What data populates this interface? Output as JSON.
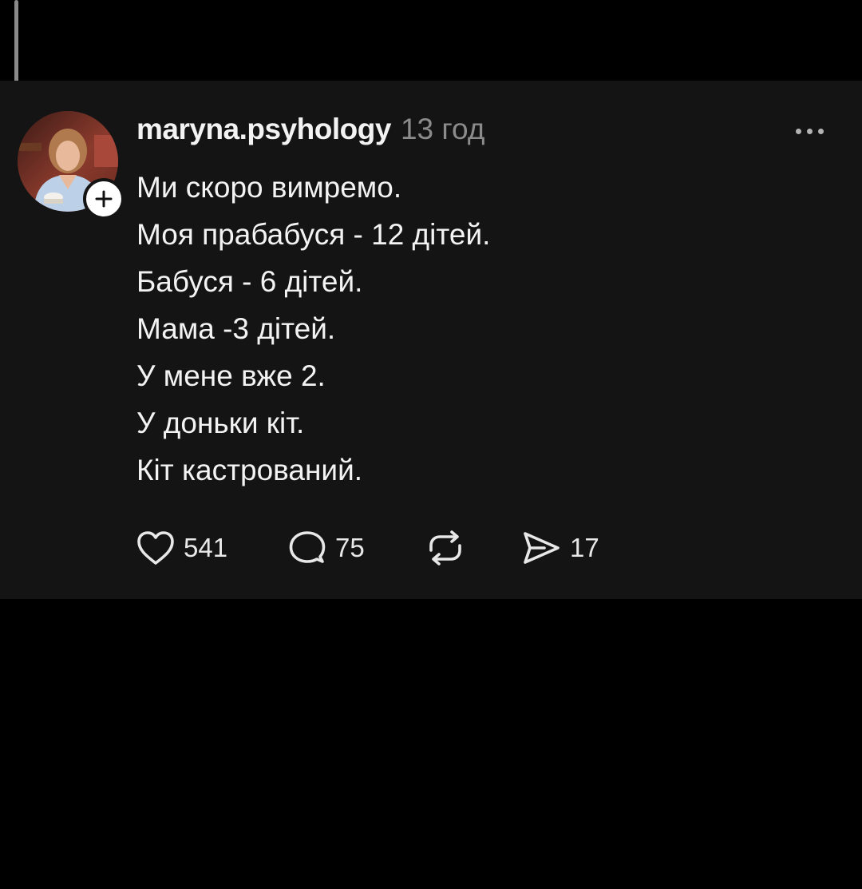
{
  "post": {
    "author": {
      "username": "maryna.psyhology",
      "avatar_icon": "profile-photo",
      "follow_icon": "plus-icon"
    },
    "time": "13 год",
    "more_icon": "ellipsis-icon",
    "lines": [
      "Ми скоро вимремо.",
      "Моя прабабуся - 12 дітей.",
      "Бабуся - 6 дітей.",
      "Мама -3 дітей.",
      "У мене вже 2.",
      "У доньки кіт.",
      "Кіт кастрований."
    ],
    "actions": {
      "likes": "541",
      "replies": "75",
      "shares": "17"
    }
  },
  "colors": {
    "card_background": "#141414",
    "page_background": "#000000",
    "text_primary": "#f3f3f3",
    "text_secondary": "#8b8b8b"
  }
}
